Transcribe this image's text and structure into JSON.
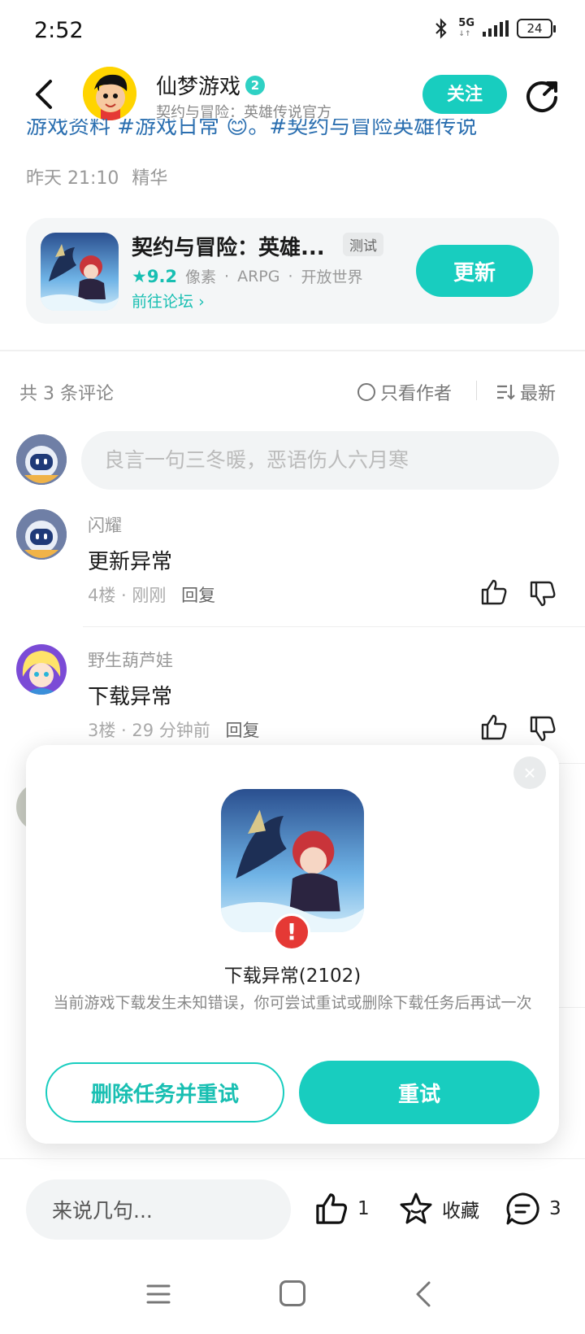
{
  "status_bar": {
    "time": "2:52",
    "network": "5G",
    "battery": "24"
  },
  "header": {
    "account_name": "仙梦游戏",
    "verify_mark": "2",
    "subtitle": "契约与冒险：英雄传说官方",
    "follow_label": "关注"
  },
  "post": {
    "cut_text": "游戏资料 #游戏日常 😊。#契约与冒险英雄传说",
    "time": "昨天 21:10",
    "tag": "精华"
  },
  "game_card": {
    "title": "契约与冒险：英雄...",
    "badge": "测试",
    "rating": "9.2",
    "tags": [
      "像素",
      "ARPG",
      "开放世界"
    ],
    "forum_link": "前往论坛",
    "update_label": "更新"
  },
  "comments_header": {
    "count": "共 3 条评论",
    "author_only": "只看作者",
    "sort": "最新"
  },
  "comment_input": {
    "placeholder": "良言一句三冬暖，恶语伤人六月寒"
  },
  "comments": [
    {
      "user": "闪耀",
      "text": "更新异常",
      "floor": "4楼",
      "time": "刚刚",
      "reply": "回复"
    },
    {
      "user": "野生葫芦娃",
      "text": "下载异常",
      "floor": "3楼",
      "time": "29 分钟前",
      "reply": "回复"
    }
  ],
  "dialog": {
    "title": "下载异常(2102)",
    "description": "当前游戏下载发生未知错误，你可尝试重试或删除下载任务后再试一次",
    "secondary_button": "删除任务并重试",
    "primary_button": "重试",
    "error_mark": "!"
  },
  "bottom_bar": {
    "input_placeholder": "来说几句...",
    "like_count": "1",
    "collect_label": "收藏",
    "comment_count": "3"
  },
  "colors": {
    "accent": "#18cdbf",
    "link": "#2b6fb0",
    "error": "#e53935"
  }
}
